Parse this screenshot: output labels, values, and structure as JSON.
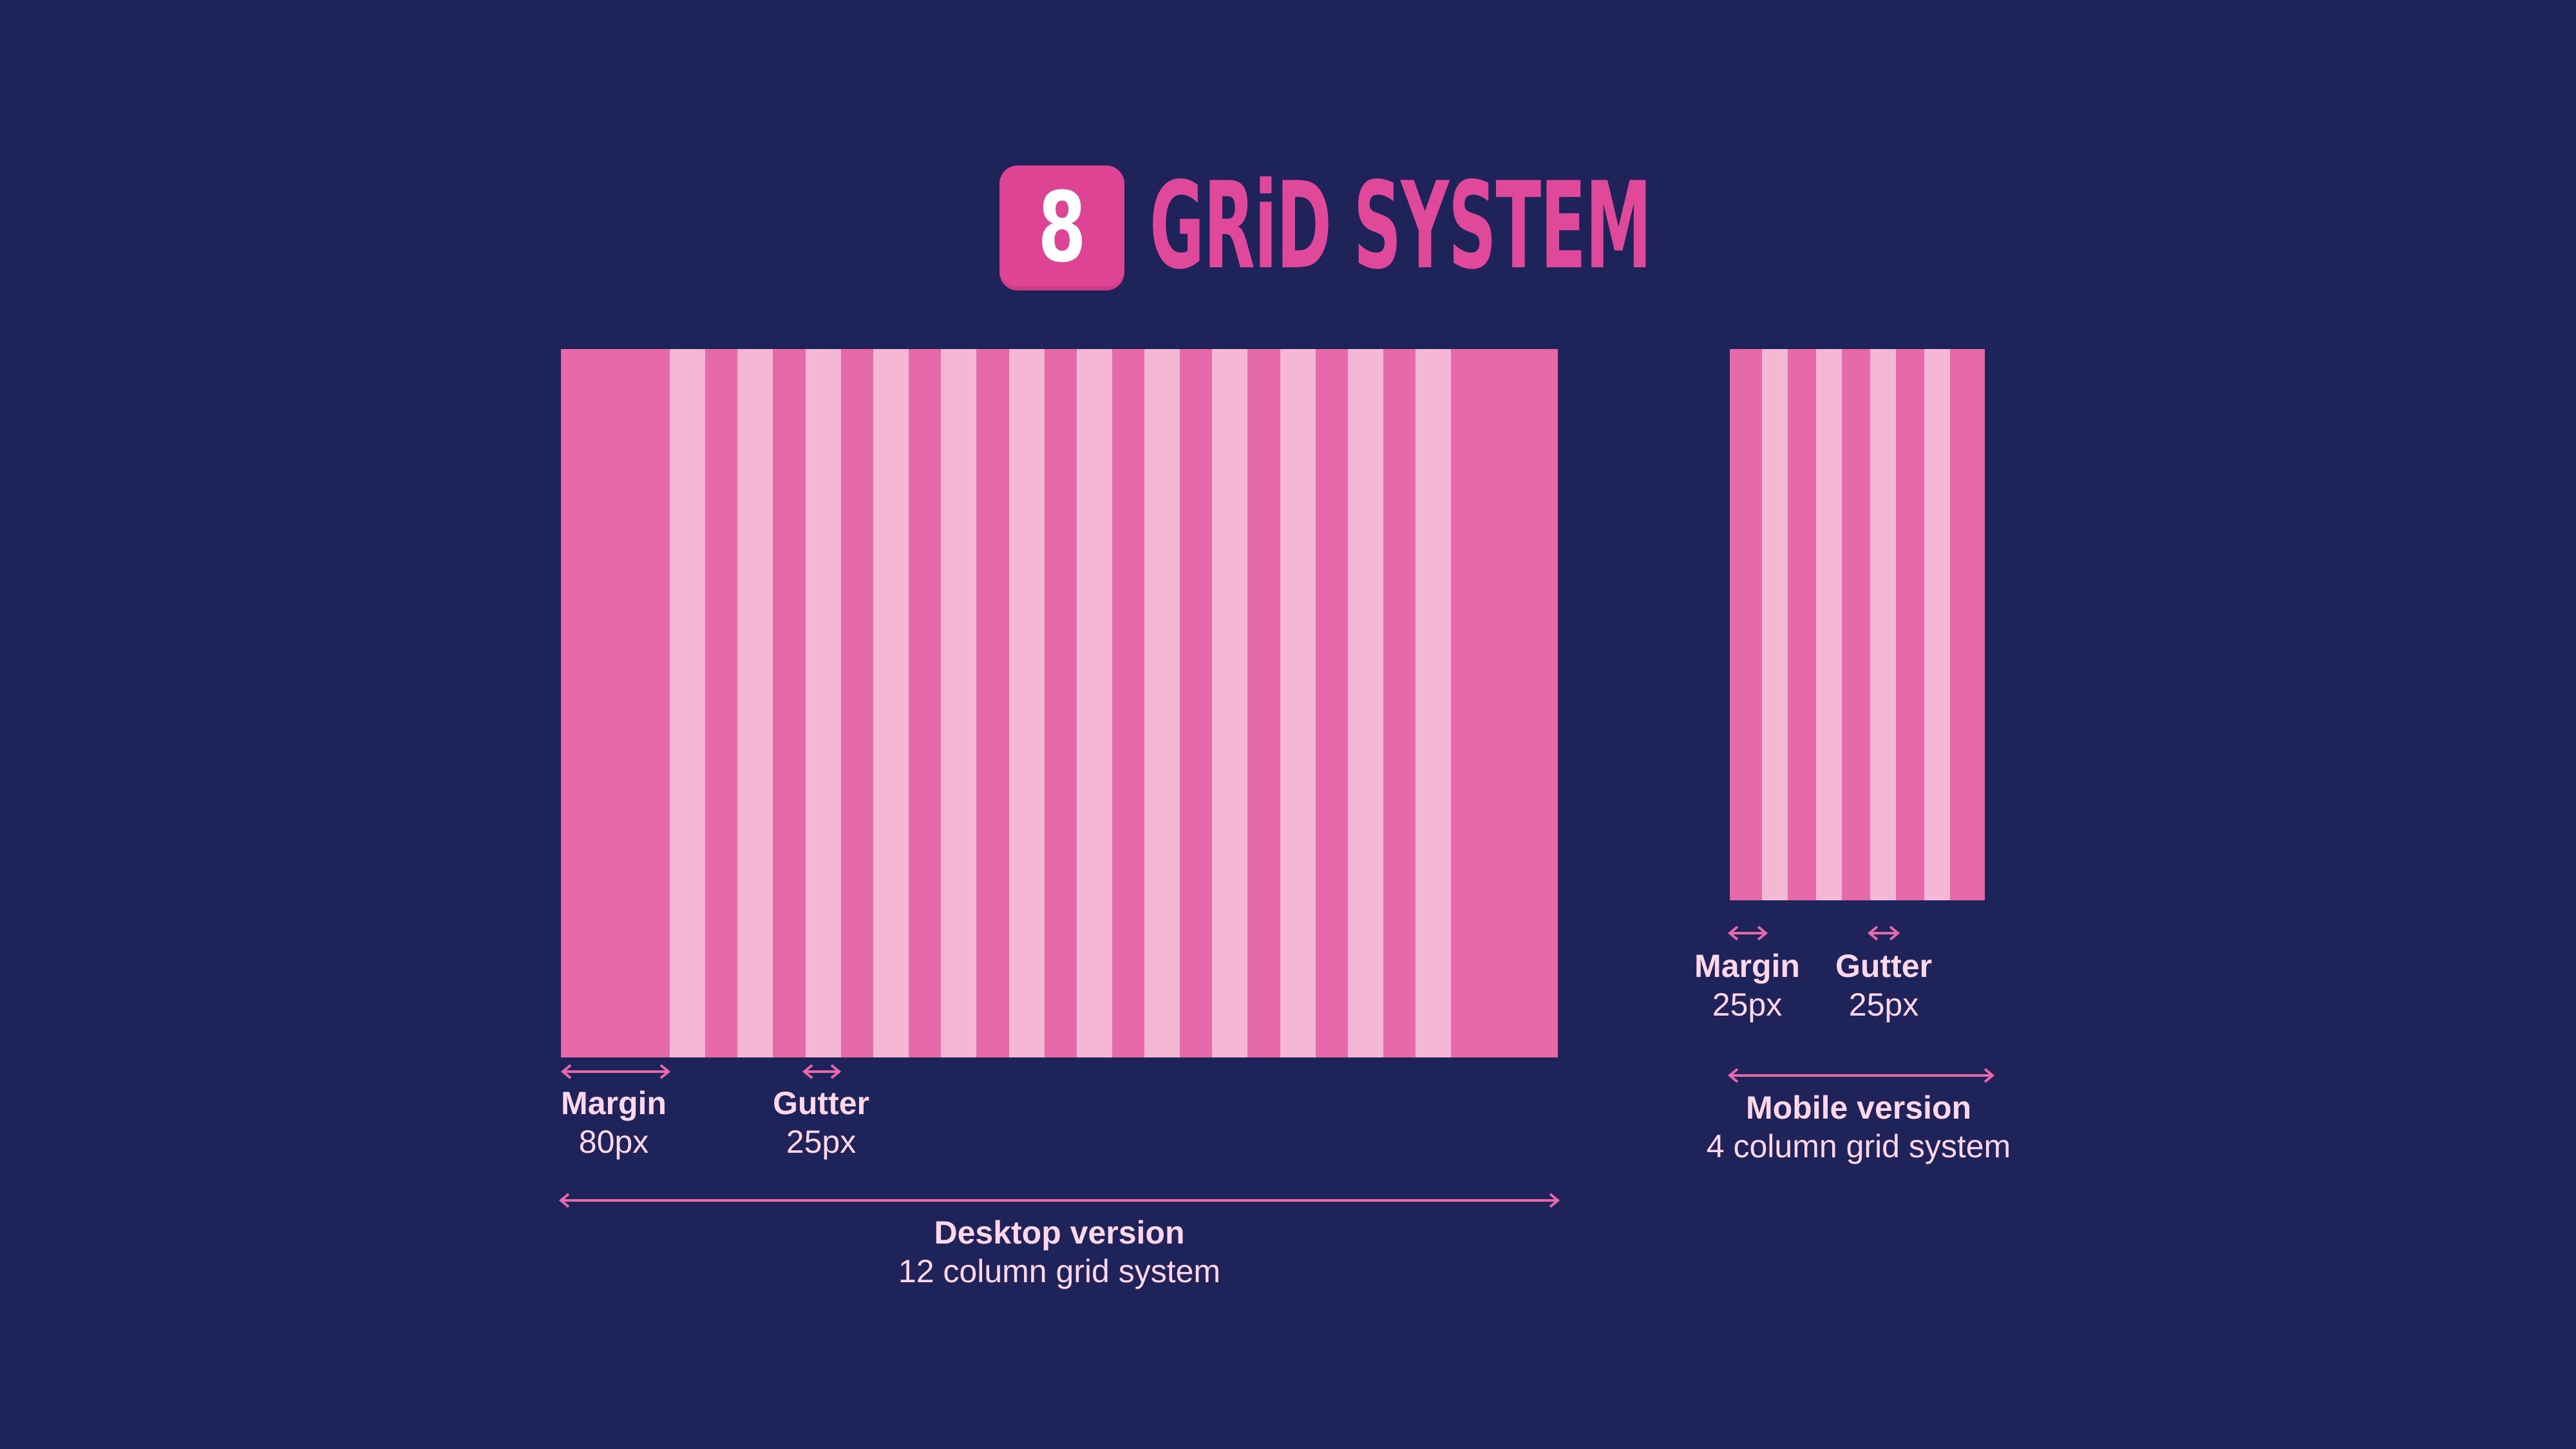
{
  "header": {
    "badge_text": "8",
    "title": "GRiD SYSTEM"
  },
  "colors": {
    "background": "#1e2359",
    "accent": "#e0499a",
    "column": "#e66aaa",
    "gutter": "#f4b8d5",
    "label_text": "#ffd7ea"
  },
  "desktop": {
    "margin_label": "Margin",
    "margin_value": "80px",
    "gutter_label": "Gutter",
    "gutter_value": "25px",
    "version_label": "Desktop version",
    "version_desc": "12 column grid system"
  },
  "mobile": {
    "margin_label": "Margin",
    "margin_value": "25px",
    "gutter_label": "Gutter",
    "gutter_value": "25px",
    "version_label": "Mobile version",
    "version_desc": "4 column grid system"
  }
}
